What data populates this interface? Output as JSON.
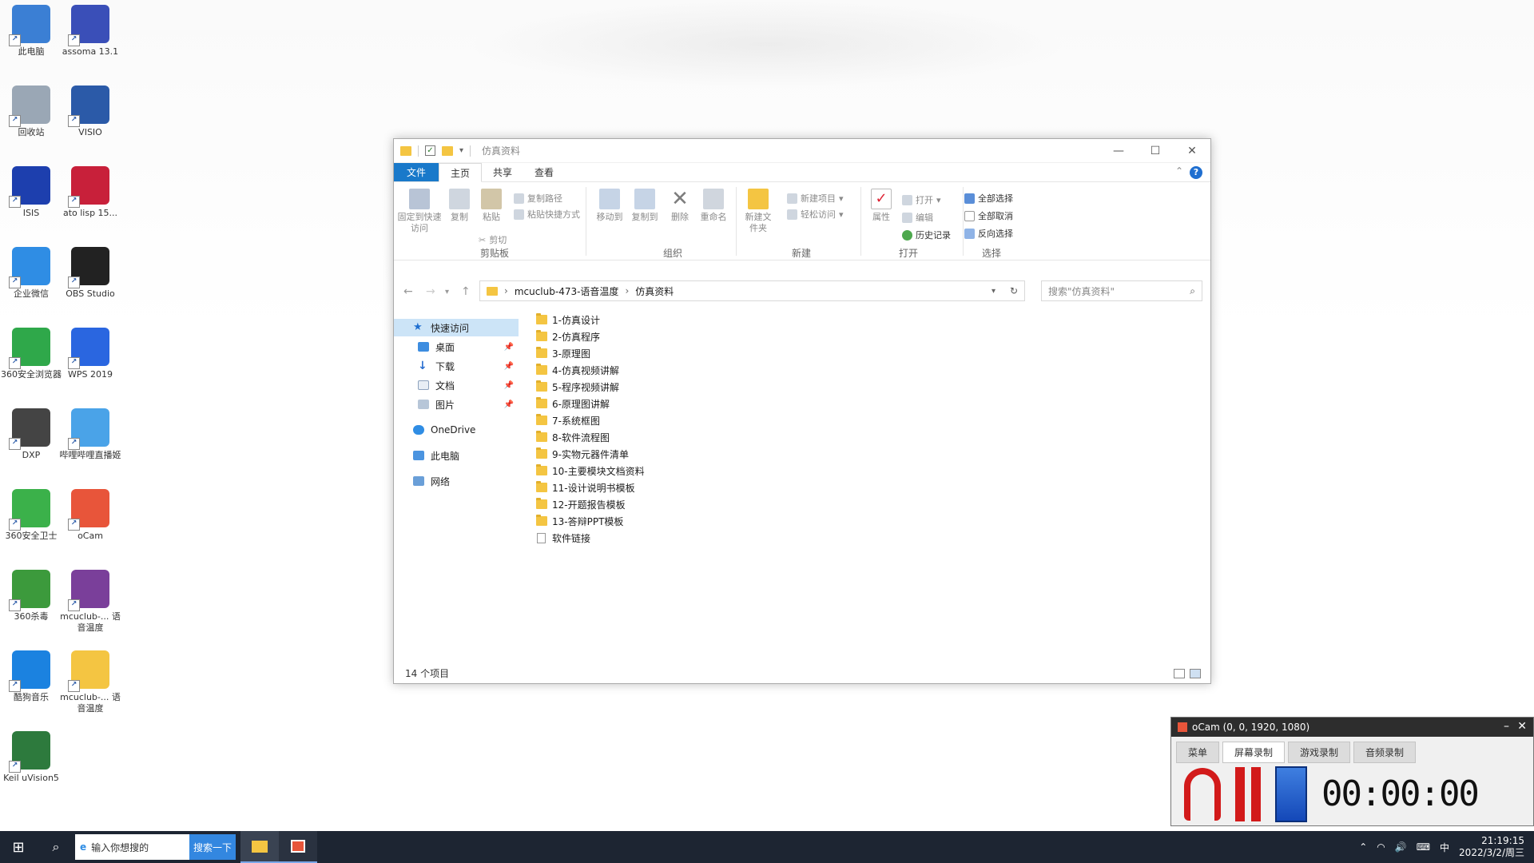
{
  "desktop": {
    "icons": [
      {
        "label": "此电脑",
        "icon": "computer-icon",
        "color": "#3b7fd4"
      },
      {
        "label": "assoma 13.1",
        "icon": "building-icon",
        "color": "#3a4fb8"
      },
      {
        "label": "回收站",
        "icon": "recycle-bin-icon",
        "color": "#9aa7b5"
      },
      {
        "label": "VISIO",
        "icon": "visio-icon",
        "color": "#2b5aa8"
      },
      {
        "label": "ISIS",
        "icon": "isis-icon",
        "color": "#1d3fae"
      },
      {
        "label": "ato lisp 15...",
        "icon": "altium-icon",
        "color": "#c8203a"
      },
      {
        "label": "企业微信",
        "icon": "wecom-icon",
        "color": "#2f8de4"
      },
      {
        "label": "OBS Studio",
        "icon": "obs-icon",
        "color": "#222222"
      },
      {
        "label": "360安全浏览器",
        "icon": "360-browser-icon",
        "color": "#2fa84a"
      },
      {
        "label": "WPS 2019",
        "icon": "wps-icon",
        "color": "#2a66e0"
      },
      {
        "label": "DXP",
        "icon": "dxp-icon",
        "color": "#444444"
      },
      {
        "label": "哔哩哔哩直播姬",
        "icon": "bilibili-live-icon",
        "color": "#4aa3e8"
      },
      {
        "label": "360安全卫士",
        "icon": "360-guard-icon",
        "color": "#3bb14a"
      },
      {
        "label": "oCam",
        "icon": "ocam-icon",
        "color": "#e8553a"
      },
      {
        "label": "360杀毒",
        "icon": "360-antivirus-icon",
        "color": "#3c9a3c"
      },
      {
        "label": "mcuclub-... 语音温度",
        "icon": "winrar-icon",
        "color": "#7a3f9a"
      },
      {
        "label": "酷狗音乐",
        "icon": "kugou-icon",
        "color": "#1b82e0"
      },
      {
        "label": "mcuclub-... 语音温度",
        "icon": "folder-icon",
        "color": "#f4c542"
      },
      {
        "label": "Keil uVision5",
        "icon": "keil-icon",
        "color": "#2d7a3d"
      }
    ]
  },
  "explorer": {
    "title": "仿真资料",
    "tabs": [
      "文件",
      "主页",
      "共享",
      "查看"
    ],
    "ribbon": {
      "clipboard": {
        "pin": "固定到快速访问",
        "copy": "复制",
        "paste": "粘贴",
        "copy_path": "复制路径",
        "paste_shortcut": "粘贴快捷方式",
        "cut": "剪切",
        "label": "剪贴板"
      },
      "organize": {
        "move_to": "移动到",
        "copy_to": "复制到",
        "delete": "删除",
        "rename": "重命名",
        "label": "组织"
      },
      "new": {
        "new_folder": "新建文件夹",
        "new_item": "新建项目",
        "easy_access": "轻松访问",
        "label": "新建"
      },
      "open": {
        "properties": "属性",
        "open": "打开",
        "edit": "编辑",
        "history": "历史记录",
        "label": "打开"
      },
      "select": {
        "select_all": "全部选择",
        "select_none": "全部取消",
        "invert": "反向选择",
        "label": "选择"
      }
    },
    "breadcrumb": [
      "mcuclub-473-语音温度",
      "仿真资料"
    ],
    "search_placeholder": "搜索\"仿真资料\"",
    "nav": {
      "quick_access": "快速访问",
      "desktop": "桌面",
      "downloads": "下载",
      "documents": "文档",
      "pictures": "图片",
      "onedrive": "OneDrive",
      "this_pc": "此电脑",
      "network": "网络"
    },
    "files": [
      {
        "name": "1-仿真设计",
        "type": "folder"
      },
      {
        "name": "2-仿真程序",
        "type": "folder"
      },
      {
        "name": "3-原理图",
        "type": "folder"
      },
      {
        "name": "4-仿真视频讲解",
        "type": "folder"
      },
      {
        "name": "5-程序视频讲解",
        "type": "folder"
      },
      {
        "name": "6-原理图讲解",
        "type": "folder"
      },
      {
        "name": "7-系统框图",
        "type": "folder"
      },
      {
        "name": "8-软件流程图",
        "type": "folder"
      },
      {
        "name": "9-实物元器件清单",
        "type": "folder"
      },
      {
        "name": "10-主要模块文档资料",
        "type": "folder"
      },
      {
        "name": "11-设计说明书模板",
        "type": "folder"
      },
      {
        "name": "12-开题报告模板",
        "type": "folder"
      },
      {
        "name": "13-答辩PPT模板",
        "type": "folder"
      },
      {
        "name": "软件链接",
        "type": "file"
      }
    ],
    "status": "14 个项目"
  },
  "ocam": {
    "title": "oCam (0, 0, 1920, 1080)",
    "tabs": [
      "菜单",
      "屏幕录制",
      "游戏录制",
      "音频录制"
    ],
    "timer": "00:00:00"
  },
  "taskbar": {
    "search_text": "输入你想搜的",
    "search_button": "搜索一下",
    "ime": "中",
    "time": "21:19:15",
    "date": "2022/3/2/周三"
  },
  "colors": {
    "accent": "#1979ca",
    "folder": "#f4c542",
    "taskbar": "#1d2532",
    "record": "#d21a1a"
  }
}
